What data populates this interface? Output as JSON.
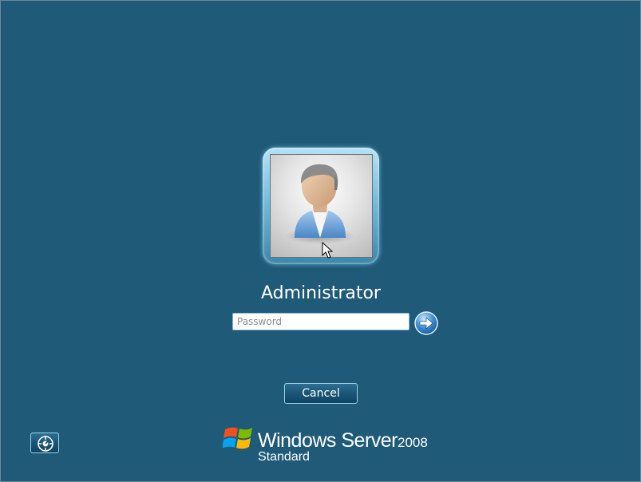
{
  "user": {
    "name": "Administrator",
    "avatar_icon": "user-tile-icon"
  },
  "password": {
    "placeholder": "Password",
    "value": "",
    "submit_icon": "arrow-right-icon"
  },
  "actions": {
    "cancel_label": "Cancel",
    "ease_of_access_icon": "ease-of-access-icon"
  },
  "branding": {
    "logo_icon": "windows-flag-icon",
    "product_name": "Windows Server",
    "version": "2008",
    "edition": "Standard"
  },
  "colors": {
    "background": "#1f5a78",
    "frame_glow": "#75bddd",
    "button_border": "#9fd0e6"
  }
}
